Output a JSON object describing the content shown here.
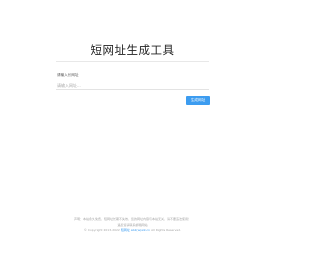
{
  "header": {
    "title": "短网址生成工具"
  },
  "form": {
    "url_label": "请输入长网址",
    "url_placeholder": "请输入网址...",
    "url_value": "",
    "generate_button": "生成网址"
  },
  "footer": {
    "disclaimer": "声明：本站永久免费，短网址长期不失效，您的网址内容与本站无关，请不要违法使用！",
    "contact": "遇反馈请联系邮箱网站",
    "copyright_prefix": "© Copyright 2013-2022",
    "copyright_link": "短网址 ab2(w)w9.cn",
    "copyright_suffix": "All Rights Reserved."
  },
  "colors": {
    "accent": "#3c9cf0",
    "title_text": "#222222",
    "muted_text": "#a6a6a6"
  }
}
